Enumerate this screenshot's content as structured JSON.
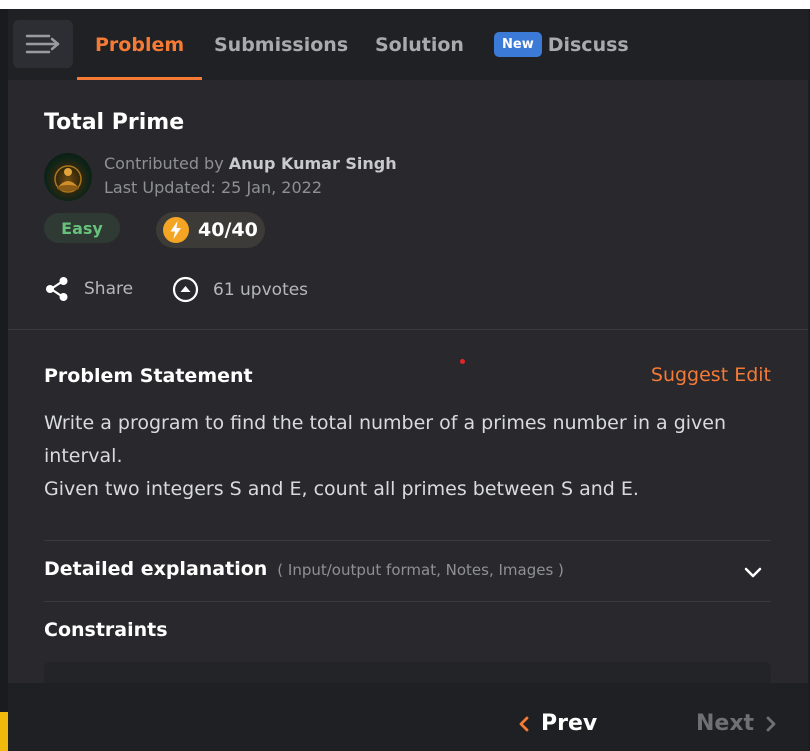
{
  "tabs": {
    "problem": "Problem",
    "submissions": "Submissions",
    "solution": "Solution",
    "new_badge": "New",
    "discuss": "Discuss"
  },
  "problem": {
    "title": "Total Prime",
    "contributed_prefix": "Contributed by",
    "author": "Anup Kumar Singh",
    "last_updated": "Last Updated: 25 Jan, 2022",
    "difficulty": "Easy",
    "score": "40/40",
    "share_label": "Share",
    "upvotes": "61 upvotes"
  },
  "statement": {
    "heading": "Problem Statement",
    "suggest_edit": "Suggest Edit",
    "line1": "Write a program to find the total number of a primes number in a given interval.",
    "line2": "Given two integers S and E, count all primes between S and E."
  },
  "details": {
    "title": "Detailed explanation",
    "subtitle": "( Input/output format, Notes, Images )",
    "constraints": "Constraints"
  },
  "nav": {
    "prev": "Prev",
    "next": "Next"
  },
  "colors": {
    "accent": "#f47a36",
    "easy": "#67c27c",
    "new_badge": "#3b7ad6"
  },
  "icons": [
    "menu-icon",
    "lightning-icon",
    "share-icon",
    "upvote-icon",
    "chevron-down-icon",
    "chevron-left-icon",
    "chevron-right-icon"
  ]
}
